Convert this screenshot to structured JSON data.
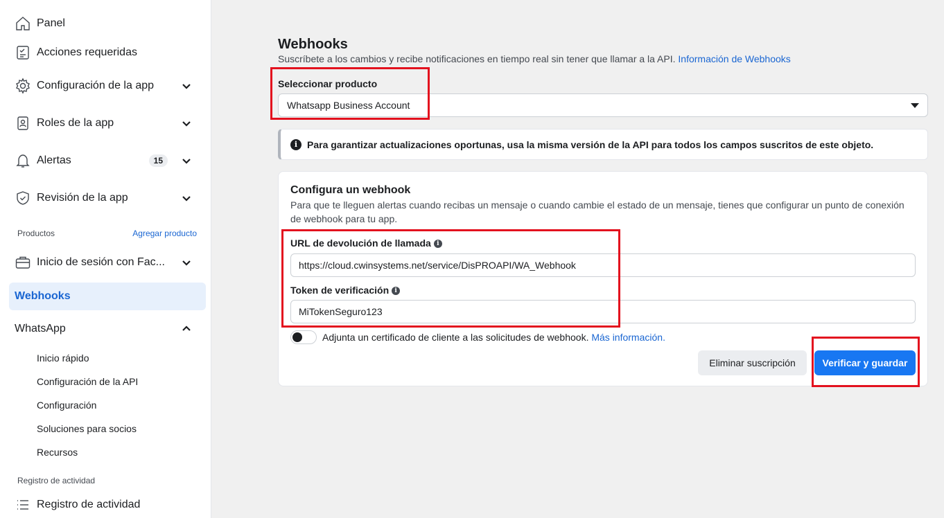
{
  "sidebar": {
    "items": [
      {
        "label": "Panel"
      },
      {
        "label": "Acciones requeridas"
      },
      {
        "label": "Configuración de la app"
      },
      {
        "label": "Roles de la app"
      },
      {
        "label": "Alertas",
        "badge": "15"
      },
      {
        "label": "Revisión de la app"
      }
    ],
    "products_label": "Productos",
    "add_product_label": "Agregar producto",
    "facebook_login_label": "Inicio de sesión con Fac...",
    "webhooks_label": "Webhooks",
    "whatsapp_label": "WhatsApp",
    "whatsapp_sub": [
      "Inicio rápido",
      "Configuración de la API",
      "Configuración",
      "Soluciones para socios",
      "Recursos"
    ],
    "activity_section_label": "Registro de actividad",
    "activity_item_label": "Registro de actividad"
  },
  "main": {
    "title": "Webhooks",
    "subtitle": "Suscríbete a los cambios y recibe notificaciones en tiempo real sin tener que llamar a la API.",
    "subtitle_link": "Información de Webhooks",
    "select_label": "Seleccionar producto",
    "select_value": "Whatsapp Business Account",
    "info_banner": "Para garantizar actualizaciones oportunas, usa la misma versión de la API para todos los campos suscritos de este objeto.",
    "card": {
      "title": "Configura un webhook",
      "description": "Para que te lleguen alertas cuando recibas un mensaje o cuando cambie el estado de un mensaje, tienes que configurar un punto de conexión de webhook para tu app.",
      "callback_label": "URL de devolución de llamada",
      "callback_value": "https://cloud.cwinsystems.net/service/DisPROAPI/WA_Webhook",
      "token_label": "Token de verificación",
      "token_value": "MiTokenSeguro123",
      "toggle_text": "Adjunta un certificado de cliente a las solicitudes de webhook.",
      "toggle_link": "Más información.",
      "delete_button": "Eliminar suscripción",
      "verify_button": "Verificar y guardar"
    }
  },
  "colors": {
    "accent": "#1877f2",
    "link": "#1a66d2",
    "annotation": "#e3111e"
  }
}
